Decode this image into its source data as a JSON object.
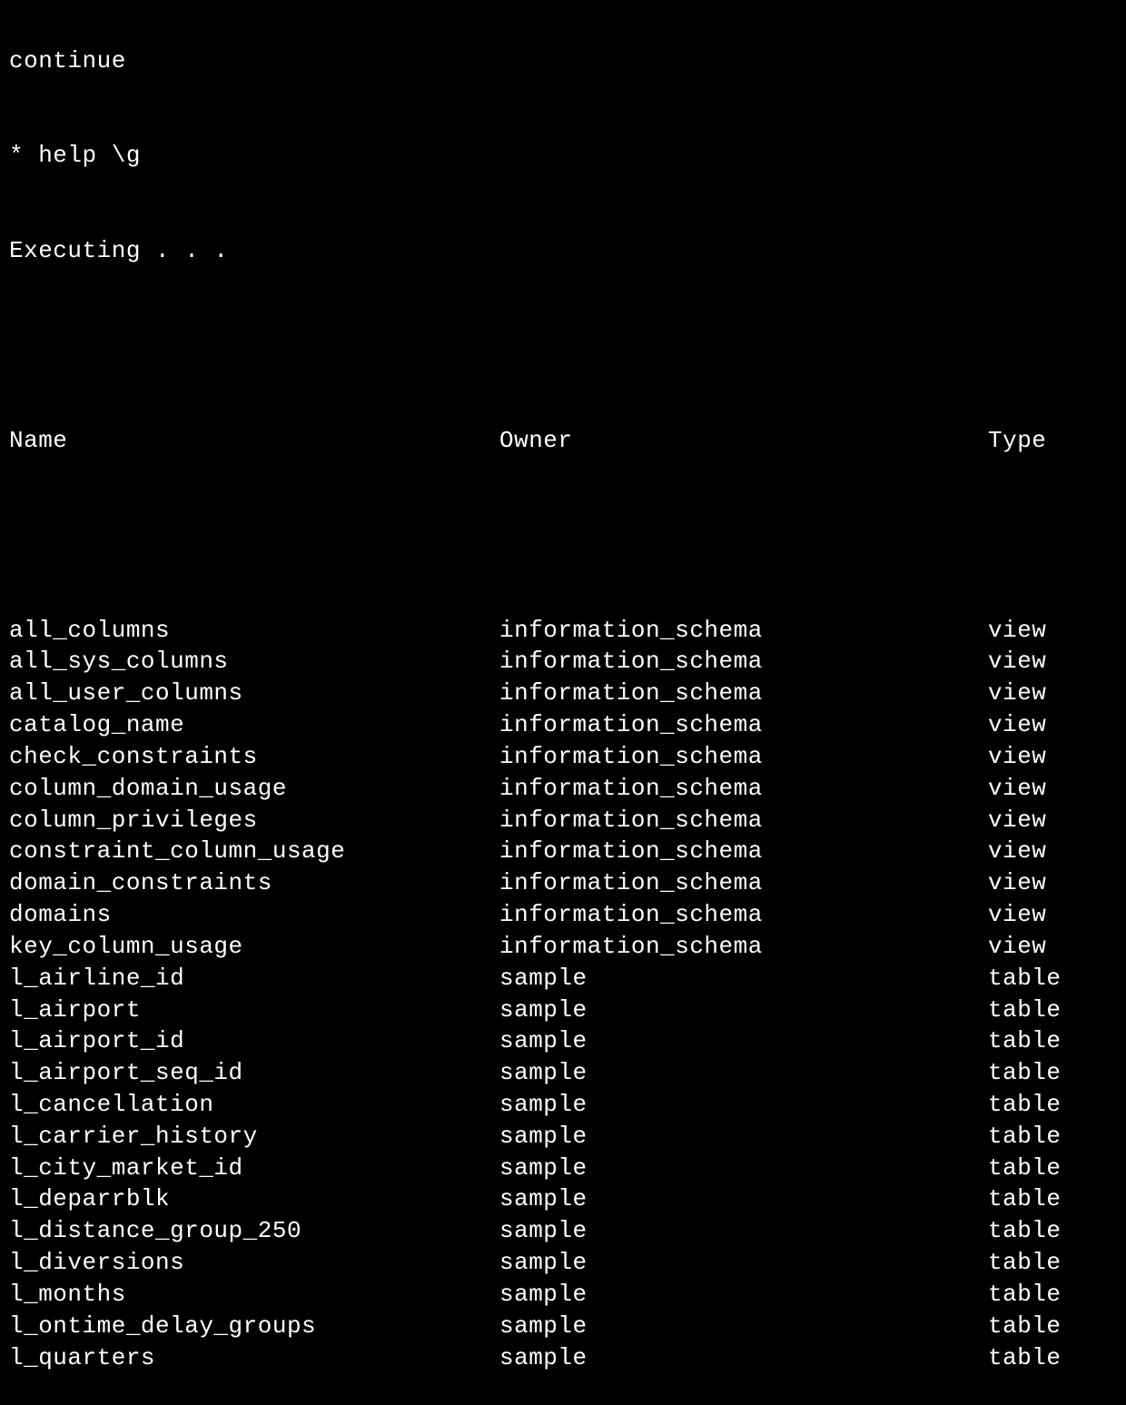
{
  "preamble": {
    "partial_line": "continue",
    "help_line": "* help \\g",
    "executing_line": "Executing . . ."
  },
  "headers": {
    "name": "Name",
    "owner": "Owner",
    "type": "Type"
  },
  "rows": [
    {
      "name": "all_columns",
      "owner": "information_schema",
      "type": "view"
    },
    {
      "name": "all_sys_columns",
      "owner": "information_schema",
      "type": "view"
    },
    {
      "name": "all_user_columns",
      "owner": "information_schema",
      "type": "view"
    },
    {
      "name": "catalog_name",
      "owner": "information_schema",
      "type": "view"
    },
    {
      "name": "check_constraints",
      "owner": "information_schema",
      "type": "view"
    },
    {
      "name": "column_domain_usage",
      "owner": "information_schema",
      "type": "view"
    },
    {
      "name": "column_privileges",
      "owner": "information_schema",
      "type": "view"
    },
    {
      "name": "constraint_column_usage",
      "owner": "information_schema",
      "type": "view"
    },
    {
      "name": "domain_constraints",
      "owner": "information_schema",
      "type": "view"
    },
    {
      "name": "domains",
      "owner": "information_schema",
      "type": "view"
    },
    {
      "name": "key_column_usage",
      "owner": "information_schema",
      "type": "view"
    },
    {
      "name": "l_airline_id",
      "owner": "sample",
      "type": "table"
    },
    {
      "name": "l_airport",
      "owner": "sample",
      "type": "table"
    },
    {
      "name": "l_airport_id",
      "owner": "sample",
      "type": "table"
    },
    {
      "name": "l_airport_seq_id",
      "owner": "sample",
      "type": "table"
    },
    {
      "name": "l_cancellation",
      "owner": "sample",
      "type": "table"
    },
    {
      "name": "l_carrier_history",
      "owner": "sample",
      "type": "table"
    },
    {
      "name": "l_city_market_id",
      "owner": "sample",
      "type": "table"
    },
    {
      "name": "l_deparrblk",
      "owner": "sample",
      "type": "table"
    },
    {
      "name": "l_distance_group_250",
      "owner": "sample",
      "type": "table"
    },
    {
      "name": "l_diversions",
      "owner": "sample",
      "type": "table"
    },
    {
      "name": "l_months",
      "owner": "sample",
      "type": "table"
    },
    {
      "name": "l_ontime_delay_groups",
      "owner": "sample",
      "type": "table"
    },
    {
      "name": "l_quarters",
      "owner": "sample",
      "type": "table"
    }
  ]
}
